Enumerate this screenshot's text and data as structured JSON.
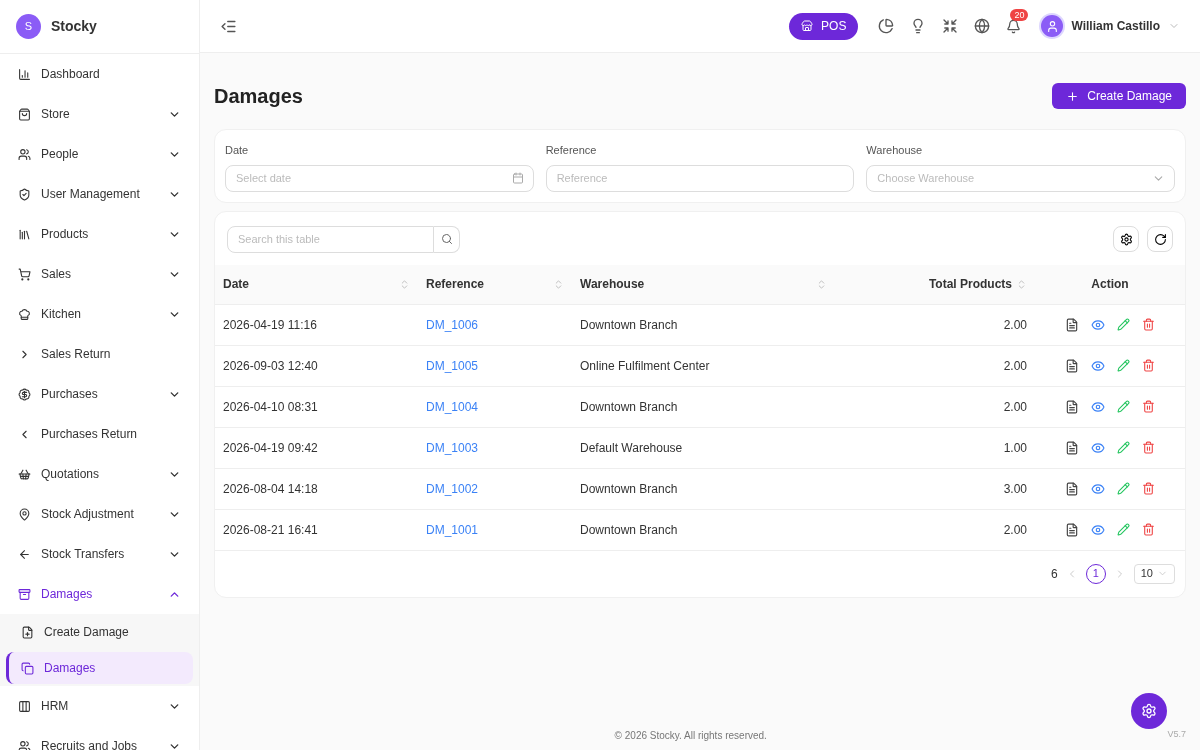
{
  "brand": {
    "name": "Stocky",
    "logo_letter": "S"
  },
  "sidebar": {
    "items": [
      {
        "label": "Dashboard",
        "kind": "link"
      },
      {
        "label": "Store",
        "kind": "group",
        "expanded": false
      },
      {
        "label": "People",
        "kind": "group",
        "expanded": false
      },
      {
        "label": "User Management",
        "kind": "group",
        "expanded": false
      },
      {
        "label": "Products",
        "kind": "group",
        "expanded": false
      },
      {
        "label": "Sales",
        "kind": "group",
        "expanded": false
      },
      {
        "label": "Kitchen",
        "kind": "group",
        "expanded": false
      },
      {
        "label": "Sales Return",
        "kind": "link"
      },
      {
        "label": "Purchases",
        "kind": "group",
        "expanded": false
      },
      {
        "label": "Purchases Return",
        "kind": "link"
      },
      {
        "label": "Quotations",
        "kind": "group",
        "expanded": false
      },
      {
        "label": "Stock Adjustment",
        "kind": "group",
        "expanded": false
      },
      {
        "label": "Stock Transfers",
        "kind": "group",
        "expanded": false
      },
      {
        "label": "Damages",
        "kind": "group",
        "expanded": true,
        "children": [
          {
            "label": "Create Damage",
            "selected": false
          },
          {
            "label": "Damages",
            "selected": true
          }
        ]
      },
      {
        "label": "HRM",
        "kind": "group",
        "expanded": false
      },
      {
        "label": "Recruits and Jobs",
        "kind": "group",
        "expanded": false
      }
    ]
  },
  "header": {
    "pos_button": "POS",
    "notification_count": "20",
    "user_name": "William Castillo"
  },
  "page": {
    "title": "Damages",
    "create_button": "Create Damage"
  },
  "filters": [
    {
      "label": "Date",
      "placeholder": "Select date",
      "kind": "date"
    },
    {
      "label": "Reference",
      "placeholder": "Reference",
      "kind": "text"
    },
    {
      "label": "Warehouse",
      "placeholder": "Choose Warehouse",
      "kind": "select"
    }
  ],
  "table": {
    "search_placeholder": "Search this table",
    "columns": [
      {
        "label": "Date",
        "sortable": true
      },
      {
        "label": "Reference",
        "sortable": true
      },
      {
        "label": "Warehouse",
        "sortable": true
      },
      {
        "label": "Total Products",
        "sortable": true
      },
      {
        "label": "Action",
        "sortable": false
      }
    ],
    "rows": [
      {
        "date": "2026-04-19 11:16",
        "reference": "DM_1006",
        "warehouse": "Downtown Branch",
        "total_products": "2.00"
      },
      {
        "date": "2026-09-03 12:40",
        "reference": "DM_1005",
        "warehouse": "Online Fulfilment Center",
        "total_products": "2.00"
      },
      {
        "date": "2026-04-10 08:31",
        "reference": "DM_1004",
        "warehouse": "Downtown Branch",
        "total_products": "2.00"
      },
      {
        "date": "2026-04-19 09:42",
        "reference": "DM_1003",
        "warehouse": "Default Warehouse",
        "total_products": "1.00"
      },
      {
        "date": "2026-08-04 14:18",
        "reference": "DM_1002",
        "warehouse": "Downtown Branch",
        "total_products": "3.00"
      },
      {
        "date": "2026-08-21 16:41",
        "reference": "DM_1001",
        "warehouse": "Downtown Branch",
        "total_products": "2.00"
      }
    ],
    "pagination": {
      "total": "6",
      "pages": [
        {
          "label": "1",
          "selected": true
        }
      ],
      "per_page": "10"
    }
  },
  "footer": {
    "copyright": "© 2026 Stocky. All rights reserved.",
    "version": "V5.7"
  }
}
